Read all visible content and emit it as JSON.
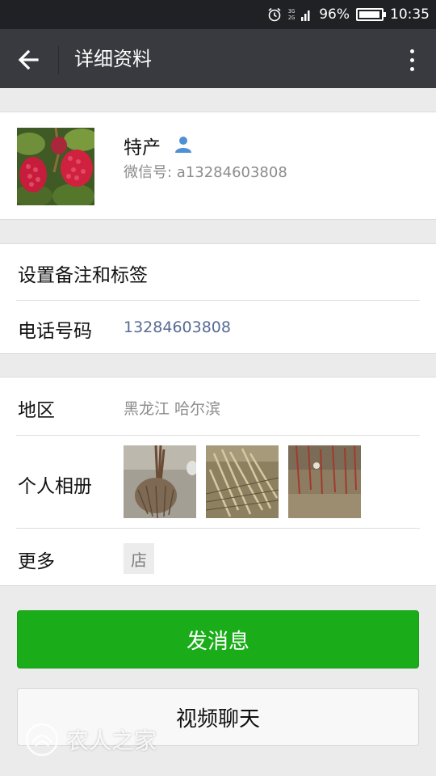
{
  "status_bar": {
    "alarm_icon": "alarm-clock-icon",
    "network_top": "3G",
    "network_bottom": "2G",
    "battery_percent": "96%",
    "battery_level": 0.96,
    "time": "10:35"
  },
  "app_bar": {
    "title": "详细资料",
    "back_icon": "arrow-left-icon",
    "menu_icon": "more-vertical-icon"
  },
  "profile": {
    "name": "特产",
    "wechat_id": "微信号: a13284603808",
    "avatar_icon": "raspberry-photo",
    "contact_icon": "person-icon"
  },
  "settings": {
    "remark_label": "设置备注和标签",
    "phone_label": "电话号码",
    "phone_value": "13284603808"
  },
  "details": {
    "region_label": "地区",
    "region_value": "黑龙江  哈尔滨",
    "album_label": "个人相册",
    "more_label": "更多",
    "shop_icon_text": "店"
  },
  "actions": {
    "send_message": "发消息",
    "video_chat": "视频聊天"
  },
  "colors": {
    "app_bar": "#393a3f",
    "status_bar": "#1f2124",
    "primary_green": "#1aad19",
    "phone_link": "#576b95"
  },
  "watermark": {
    "text": "农人之家"
  }
}
